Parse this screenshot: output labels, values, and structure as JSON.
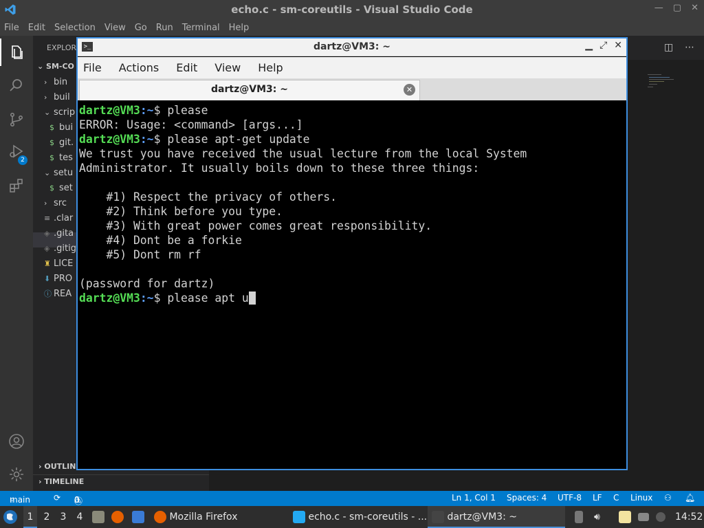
{
  "vscode": {
    "title": "echo.c - sm-coreutils - Visual Studio Code",
    "menu": [
      "File",
      "Edit",
      "Selection",
      "View",
      "Go",
      "Run",
      "Terminal",
      "Help"
    ],
    "explorer_header": "EXPLOR",
    "root_folder": "SM-CO",
    "scm_badge": "2",
    "tree": [
      {
        "label": "bin",
        "kind": "folder"
      },
      {
        "label": "buil",
        "kind": "folder"
      },
      {
        "label": "scrip",
        "kind": "folder-open"
      },
      {
        "label": "bui",
        "kind": "file-dollar"
      },
      {
        "label": "git.",
        "kind": "file-dollar"
      },
      {
        "label": "tes",
        "kind": "file-dollar"
      },
      {
        "label": "setu",
        "kind": "folder-open"
      },
      {
        "label": "set",
        "kind": "file-dollar"
      },
      {
        "label": "src",
        "kind": "folder"
      },
      {
        "label": ".clar",
        "kind": "file"
      },
      {
        "label": ".gita",
        "kind": "file-git"
      },
      {
        "label": ".gitig",
        "kind": "file-git"
      },
      {
        "label": "LICE",
        "kind": "file-license"
      },
      {
        "label": "PRO",
        "kind": "file-down"
      },
      {
        "label": "REA",
        "kind": "file-info"
      }
    ],
    "outline_label": "OUTLINE",
    "timeline_label": "TIMELINE",
    "status": {
      "branch": "main",
      "errors": "0",
      "warnings": "0",
      "position": "Ln 1, Col 1",
      "spaces": "Spaces: 4",
      "encoding": "UTF-8",
      "eol": "LF",
      "language": "C",
      "os": "Linux"
    }
  },
  "terminal": {
    "title": "dartz@VM3: ~",
    "menu": [
      "File",
      "Actions",
      "Edit",
      "View",
      "Help"
    ],
    "tab_label": "dartz@VM3: ~",
    "prompt_user": "dartz@VM3",
    "prompt_path": ":~",
    "prompt_symbol": "$ ",
    "lines": {
      "l1_cmd": "please",
      "l2": "ERROR: Usage: <command> [args...]",
      "l3_cmd": "please apt-get update",
      "l4": "We trust you have received the usual lecture from the local System",
      "l5": "Administrator. It usually boils down to these three things:",
      "l6": "",
      "l7": "    #1) Respect the privacy of others.",
      "l8": "    #2) Think before you type.",
      "l9": "    #3) With great power comes great responsibility.",
      "l10": "    #4) Dont be a forkie",
      "l11": "    #5) Dont rm rf",
      "l12": "",
      "l13": "(password for dartz)",
      "l14_cmd": "please apt u"
    }
  },
  "taskbar": {
    "workspaces": [
      "1",
      "2",
      "3",
      "4"
    ],
    "firefox_label": "Mozilla Firefox",
    "vscode_label": "echo.c - sm-coreutils - ...",
    "terminal_label": "dartz@VM3: ~",
    "clock": "14:52"
  },
  "colors": {
    "vscode_accent": "#007acc",
    "prompt_user": "#55dd55",
    "prompt_path": "#5c9cf5",
    "terminal_border": "#3d8ee0"
  }
}
